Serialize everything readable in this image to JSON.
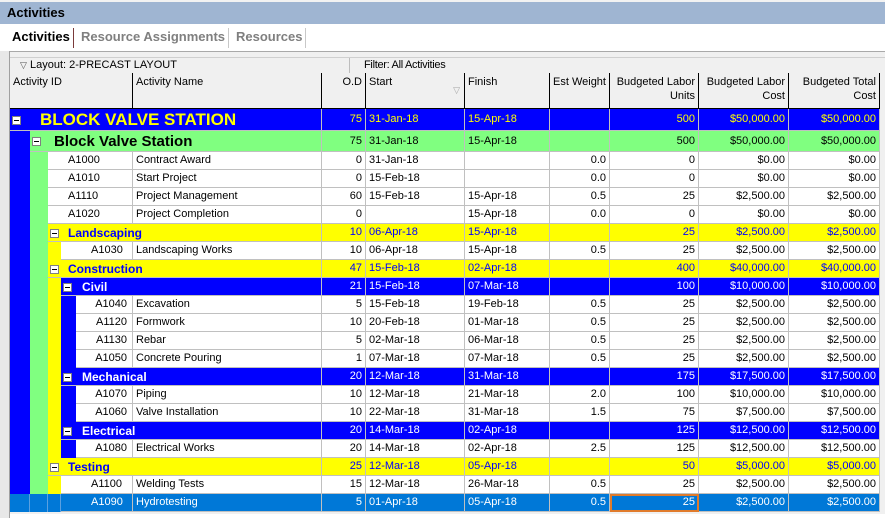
{
  "window": {
    "title": "Activities"
  },
  "tabs": [
    {
      "label": "Activities",
      "active": true
    },
    {
      "label": "Resource Assignments",
      "active": false
    },
    {
      "label": "Resources",
      "active": false
    }
  ],
  "layout_bar": {
    "layout": "Layout: 2-PRECAST LAYOUT",
    "filter": "Filter: All Activities"
  },
  "columns": [
    {
      "label": "Activity ID"
    },
    {
      "label": "Activity Name"
    },
    {
      "label": "O.D"
    },
    {
      "label": "Start"
    },
    {
      "label": "Finish"
    },
    {
      "label": "Est Weight"
    },
    {
      "label": "Budgeted Labor Units"
    },
    {
      "label": "Budgeted Labor Cost"
    },
    {
      "label": "Budgeted Total Cost"
    }
  ],
  "colors": {
    "level1_bg": "#0000ff",
    "level1_fg": "#ffff00",
    "level2_bg": "#80ff80",
    "level2_fg": "#000000",
    "level3_bg": "#ffff00",
    "level3_fg": "#0000ff",
    "level4_bg": "#0000ff",
    "level4_fg": "#ffffff",
    "selected_bg": "#0078d7",
    "selected_fg": "#ffffff",
    "focus_outline": "#e07b2c"
  },
  "rows": [
    {
      "type": "wbs",
      "level": 1,
      "name": "BLOCK VALVE STATION",
      "od": "75",
      "start": "31-Jan-18",
      "finish": "15-Apr-18",
      "weight": "",
      "units": "500",
      "labor_cost": "$50,000.00",
      "total_cost": "$50,000.00"
    },
    {
      "type": "wbs",
      "level": 2,
      "name": "Block Valve Station",
      "od": "75",
      "start": "31-Jan-18",
      "finish": "15-Apr-18",
      "weight": "",
      "units": "500",
      "labor_cost": "$50,000.00",
      "total_cost": "$50,000.00"
    },
    {
      "type": "act",
      "level": 2,
      "id": "A1000",
      "name": "Contract Award",
      "od": "0",
      "start": "31-Jan-18",
      "finish": "",
      "weight": "0.0",
      "units": "0",
      "labor_cost": "$0.00",
      "total_cost": "$0.00"
    },
    {
      "type": "act",
      "level": 2,
      "id": "A1010",
      "name": "Start Project",
      "od": "0",
      "start": "15-Feb-18",
      "finish": "",
      "weight": "0.0",
      "units": "0",
      "labor_cost": "$0.00",
      "total_cost": "$0.00"
    },
    {
      "type": "act",
      "level": 2,
      "id": "A1110",
      "name": "Project Management",
      "od": "60",
      "start": "15-Feb-18",
      "finish": "15-Apr-18",
      "weight": "0.5",
      "units": "25",
      "labor_cost": "$2,500.00",
      "total_cost": "$2,500.00"
    },
    {
      "type": "act",
      "level": 2,
      "id": "A1020",
      "name": "Project Completion",
      "od": "0",
      "start": "",
      "finish": "15-Apr-18",
      "weight": "0.0",
      "units": "0",
      "labor_cost": "$0.00",
      "total_cost": "$0.00"
    },
    {
      "type": "wbs",
      "level": 3,
      "name": "Landscaping",
      "od": "10",
      "start": "06-Apr-18",
      "finish": "15-Apr-18",
      "weight": "",
      "units": "25",
      "labor_cost": "$2,500.00",
      "total_cost": "$2,500.00"
    },
    {
      "type": "act",
      "level": 3,
      "id": "A1030",
      "name": "Landscaping Works",
      "od": "10",
      "start": "06-Apr-18",
      "finish": "15-Apr-18",
      "weight": "0.5",
      "units": "25",
      "labor_cost": "$2,500.00",
      "total_cost": "$2,500.00"
    },
    {
      "type": "wbs",
      "level": 3,
      "name": "Construction",
      "od": "47",
      "start": "15-Feb-18",
      "finish": "02-Apr-18",
      "weight": "",
      "units": "400",
      "labor_cost": "$40,000.00",
      "total_cost": "$40,000.00"
    },
    {
      "type": "wbs",
      "level": 4,
      "name": "Civil",
      "od": "21",
      "start": "15-Feb-18",
      "finish": "07-Mar-18",
      "weight": "",
      "units": "100",
      "labor_cost": "$10,000.00",
      "total_cost": "$10,000.00"
    },
    {
      "type": "act",
      "level": 4,
      "id": "A1040",
      "name": "Excavation",
      "od": "5",
      "start": "15-Feb-18",
      "finish": "19-Feb-18",
      "weight": "0.5",
      "units": "25",
      "labor_cost": "$2,500.00",
      "total_cost": "$2,500.00"
    },
    {
      "type": "act",
      "level": 4,
      "id": "A1120",
      "name": "Formwork",
      "od": "10",
      "start": "20-Feb-18",
      "finish": "01-Mar-18",
      "weight": "0.5",
      "units": "25",
      "labor_cost": "$2,500.00",
      "total_cost": "$2,500.00"
    },
    {
      "type": "act",
      "level": 4,
      "id": "A1130",
      "name": "Rebar",
      "od": "5",
      "start": "02-Mar-18",
      "finish": "06-Mar-18",
      "weight": "0.5",
      "units": "25",
      "labor_cost": "$2,500.00",
      "total_cost": "$2,500.00"
    },
    {
      "type": "act",
      "level": 4,
      "id": "A1050",
      "name": "Concrete Pouring",
      "od": "1",
      "start": "07-Mar-18",
      "finish": "07-Mar-18",
      "weight": "0.5",
      "units": "25",
      "labor_cost": "$2,500.00",
      "total_cost": "$2,500.00"
    },
    {
      "type": "wbs",
      "level": 4,
      "name": "Mechanical",
      "od": "20",
      "start": "12-Mar-18",
      "finish": "31-Mar-18",
      "weight": "",
      "units": "175",
      "labor_cost": "$17,500.00",
      "total_cost": "$17,500.00"
    },
    {
      "type": "act",
      "level": 4,
      "id": "A1070",
      "name": "Piping",
      "od": "10",
      "start": "12-Mar-18",
      "finish": "21-Mar-18",
      "weight": "2.0",
      "units": "100",
      "labor_cost": "$10,000.00",
      "total_cost": "$10,000.00"
    },
    {
      "type": "act",
      "level": 4,
      "id": "A1060",
      "name": "Valve Installation",
      "od": "10",
      "start": "22-Mar-18",
      "finish": "31-Mar-18",
      "weight": "1.5",
      "units": "75",
      "labor_cost": "$7,500.00",
      "total_cost": "$7,500.00"
    },
    {
      "type": "wbs",
      "level": 4,
      "name": "Electrical",
      "od": "20",
      "start": "14-Mar-18",
      "finish": "02-Apr-18",
      "weight": "",
      "units": "125",
      "labor_cost": "$12,500.00",
      "total_cost": "$12,500.00"
    },
    {
      "type": "act",
      "level": 4,
      "id": "A1080",
      "name": "Electrical Works",
      "od": "20",
      "start": "14-Mar-18",
      "finish": "02-Apr-18",
      "weight": "2.5",
      "units": "125",
      "labor_cost": "$12,500.00",
      "total_cost": "$12,500.00"
    },
    {
      "type": "wbs",
      "level": 3,
      "name": "Testing",
      "od": "25",
      "start": "12-Mar-18",
      "finish": "05-Apr-18",
      "weight": "",
      "units": "50",
      "labor_cost": "$5,000.00",
      "total_cost": "$5,000.00"
    },
    {
      "type": "act",
      "level": 3,
      "id": "A1100",
      "name": "Welding Tests",
      "od": "15",
      "start": "12-Mar-18",
      "finish": "26-Mar-18",
      "weight": "0.5",
      "units": "25",
      "labor_cost": "$2,500.00",
      "total_cost": "$2,500.00"
    },
    {
      "type": "act",
      "level": 3,
      "id": "A1090",
      "name": "Hydrotesting",
      "od": "5",
      "start": "01-Apr-18",
      "finish": "05-Apr-18",
      "weight": "0.5",
      "units": "25",
      "labor_cost": "$2,500.00",
      "total_cost": "$2,500.00",
      "selected": true,
      "focused_field": "units"
    }
  ]
}
